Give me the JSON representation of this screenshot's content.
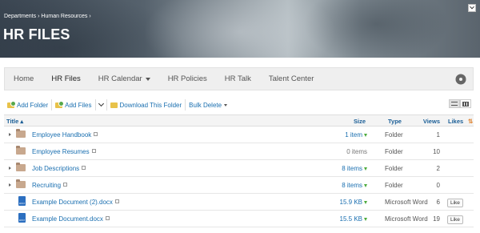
{
  "breadcrumb": {
    "items": [
      "Departments",
      "Human Resources"
    ],
    "sep": "›"
  },
  "page_title": "HR FILES",
  "nav": {
    "items": [
      {
        "label": "Home"
      },
      {
        "label": "HR Files",
        "active": true
      },
      {
        "label": "HR Calendar",
        "dropdown": true
      },
      {
        "label": "HR Policies"
      },
      {
        "label": "HR Talk"
      },
      {
        "label": "Talent Center"
      }
    ],
    "settings_icon": "gear-icon"
  },
  "toolbar": {
    "add_folder": "Add Folder",
    "add_files": "Add Files",
    "download_folder": "Download This Folder",
    "bulk_delete": "Bulk Delete"
  },
  "table": {
    "columns": {
      "title": "Title",
      "size": "Size",
      "type": "Type",
      "views": "Views",
      "likes": "Likes"
    },
    "rows": [
      {
        "kind": "folder",
        "expandable": true,
        "title": "Employee Handbook",
        "size": "1 item",
        "size_link": true,
        "type": "Folder",
        "views": "1",
        "like": ""
      },
      {
        "kind": "folder",
        "expandable": false,
        "title": "Employee Resumes",
        "size": "0 items",
        "size_link": false,
        "type": "Folder",
        "views": "10",
        "like": ""
      },
      {
        "kind": "folder",
        "expandable": true,
        "title": "Job Descriptions",
        "size": "8 items",
        "size_link": true,
        "type": "Folder",
        "views": "2",
        "like": ""
      },
      {
        "kind": "folder",
        "expandable": true,
        "title": "Recruiting",
        "size": "8 items",
        "size_link": true,
        "type": "Folder",
        "views": "0",
        "like": ""
      },
      {
        "kind": "word",
        "expandable": false,
        "title": "Example Document (2).docx",
        "size": "15.9 KB",
        "size_link": true,
        "type": "Microsoft Word",
        "views": "6",
        "like": "Like"
      },
      {
        "kind": "word",
        "expandable": false,
        "title": "Example Document.docx",
        "size": "15.5 KB",
        "size_link": true,
        "type": "Microsoft Word",
        "views": "19",
        "like": "Like"
      }
    ]
  }
}
